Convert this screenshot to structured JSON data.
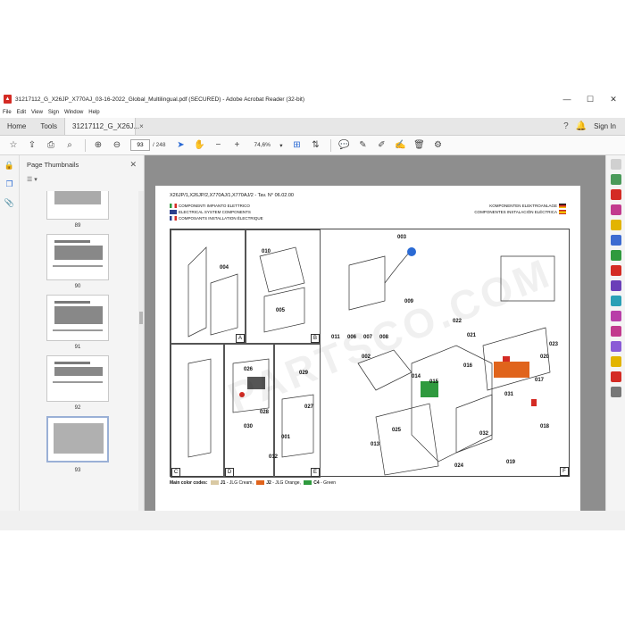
{
  "window": {
    "title": "31217112_G_X26JP_X770AJ_03-16-2022_Global_Multilingual.pdf (SECURED) - Adobe Acrobat Reader (32-bit)",
    "minimize": "—",
    "maximize": "☐",
    "close": "✕"
  },
  "menu": [
    "File",
    "Edit",
    "View",
    "Sign",
    "Window",
    "Help"
  ],
  "tabs": {
    "home": "Home",
    "tools": "Tools",
    "document": "31217112_G_X26J...",
    "close": "×",
    "signin": "Sign In"
  },
  "toolbar": {
    "page_current": "93",
    "page_total": "/ 248",
    "zoom": "74,6%"
  },
  "thumbnails": {
    "title": "Page Thumbnails",
    "close": "✕",
    "options": "☰ ▾",
    "pages": [
      "89",
      "90",
      "91",
      "92",
      "93"
    ]
  },
  "document": {
    "header": "X26JP/1,X26JP/2,X770AJ/1,X770AJ/2 - Tav. N° 06.02.00",
    "lang_it": "COMPONENTI IMPIANTO ELETTRICO",
    "lang_en": "ELECTRICAL SYSTEM COMPONENTS",
    "lang_fr": "COMPOSANTS INSTALLATION ÉLECTRIQUE",
    "lang_de": "KOMPONENTEN ELEKTROANLAGE",
    "lang_es": "COMPONENTES INSTALACIÓN ELÉCTRICA",
    "watermark": "PARTSCO.COM",
    "panel_labels": [
      "A",
      "B",
      "C",
      "D",
      "E",
      "F"
    ],
    "codes": [
      "004",
      "010",
      "005",
      "003",
      "009",
      "011",
      "006",
      "007",
      "008",
      "002",
      "014",
      "015",
      "016",
      "022",
      "021",
      "023",
      "020",
      "017",
      "018",
      "019",
      "024",
      "025",
      "026",
      "028",
      "029",
      "027",
      "030",
      "001",
      "012",
      "013",
      "031",
      "032"
    ],
    "legend_title": "Main color codes:",
    "legend_items": [
      {
        "code": "J1",
        "label": " - JLG Cream,",
        "color": "#d9c9a3"
      },
      {
        "code": "J2",
        "label": " - JLG Orange,",
        "color": "#e0641c"
      },
      {
        "code": "C4",
        "label": " - Green",
        "color": "#2f9a3e"
      }
    ]
  },
  "colors": {
    "accent": "#2a6ad4",
    "pdf_red": "#d42b24",
    "viewer_bg": "#8e8e8e"
  }
}
